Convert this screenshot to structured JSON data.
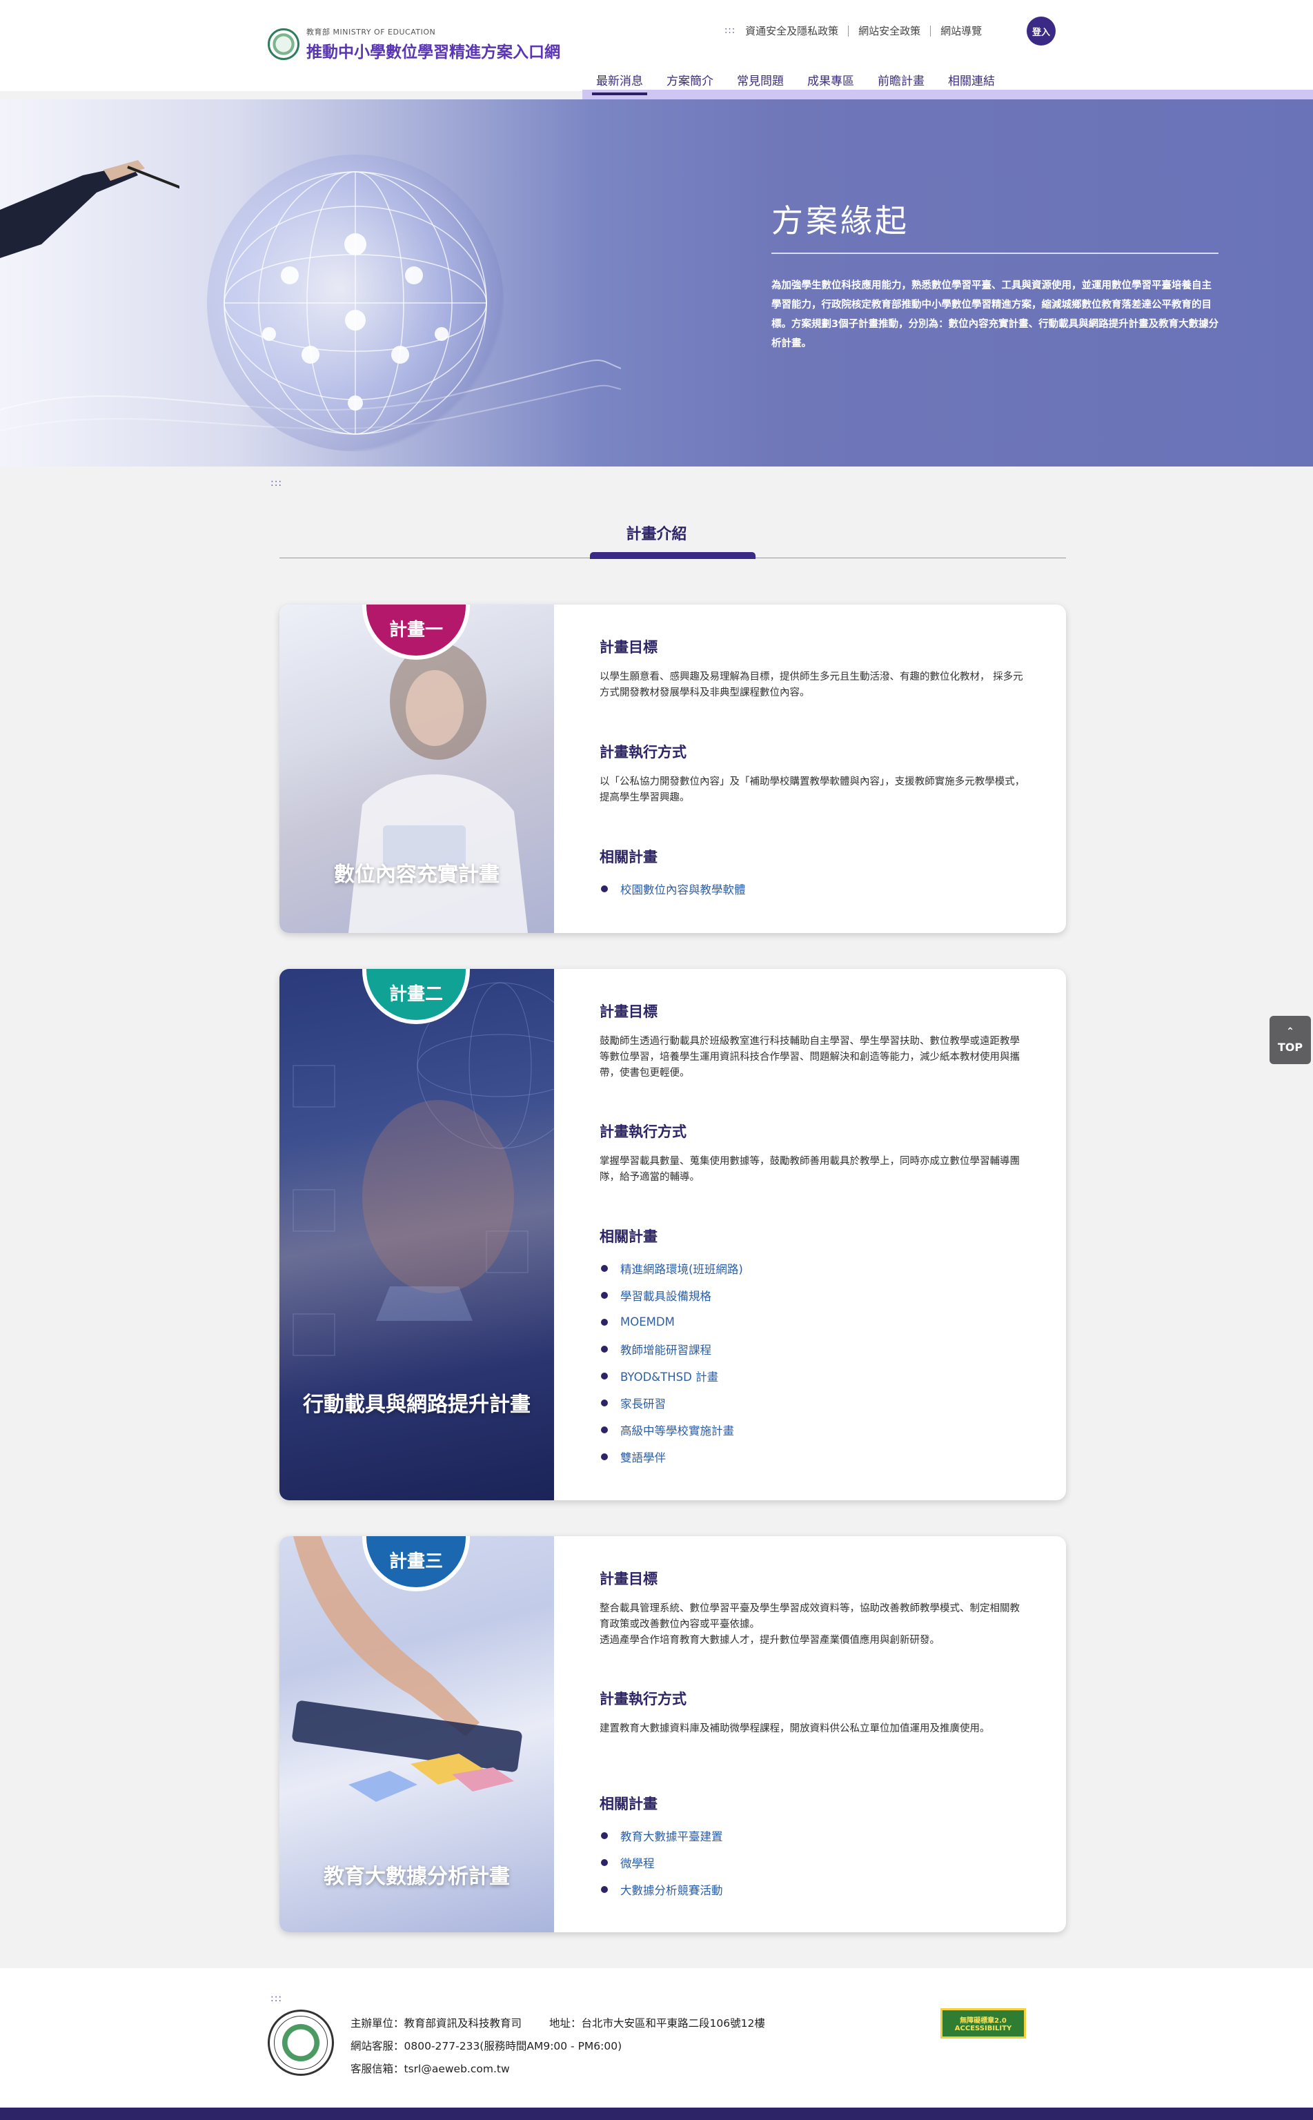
{
  "header": {
    "ministry": "教育部 MINISTRY OF EDUCATION",
    "site_title": "推動中小學數位學習精進方案入口網",
    "util_dots": ":::",
    "util_links": [
      "資通安全及隱私政策",
      "網站安全政策",
      "網站導覽"
    ],
    "login": "登入",
    "nav": [
      "最新消息",
      "方案簡介",
      "常見問題",
      "成果專區",
      "前瞻計畫",
      "相關連結"
    ],
    "active_nav": "最新消息"
  },
  "hero": {
    "title": "方案緣起",
    "description": "為加強學生數位科技應用能力，熟悉數位學習平臺、工具與資源使用，並運用數位學習平臺培養自主學習能力，行政院核定教育部推動中小學數位學習精進方案，縮減城鄉數位教育落差達公平教育的目標。方案規劃3個子計畫推動，分別為：數位內容充實計畫、行動載具與網路提升計畫及教育大數據分析計畫。"
  },
  "section": {
    "dots": ":::",
    "title": "計畫介紹"
  },
  "labels": {
    "goal": "計畫目標",
    "method": "計畫執行方式",
    "related": "相關計畫"
  },
  "plans": [
    {
      "badge": "計畫一",
      "badge_color": "#b3186b",
      "name": "數位內容充實計畫",
      "goal": "以學生願意看、感興趣及易理解為目標，提供師生多元且生動活潑、有趣的數位化教材， 採多元方式開發教材發展學科及非典型課程數位內容。",
      "method": "以「公私協力開發數位內容」及「補助學校購置教學軟體與內容」，支援教師實施多元教學模式，提高學生學習興趣。",
      "related": [
        "校園數位內容與教學軟體"
      ]
    },
    {
      "badge": "計畫二",
      "badge_color": "#0fa295",
      "name": "行動載具與網路提升計畫",
      "goal": "鼓勵師生透過行動載具於班級教室進行科技輔助自主學習、學生學習扶助、數位教學或遠距教學等數位學習，培養學生運用資訊科技合作學習、問題解決和創造等能力，減少紙本教材使用與攜帶，使書包更輕便。",
      "method": "掌握學習載具數量、蒐集使用數據等，鼓勵教師善用載具於教學上，同時亦成立數位學習輔導團隊，給予適當的輔導。",
      "related": [
        "精進網路環境(班班網路)",
        "學習載具設備規格",
        "MOEMDM",
        "教師增能研習課程",
        "BYOD&THSD 計畫",
        "家長研習",
        "高級中等學校實施計畫",
        "雙語學伴"
      ]
    },
    {
      "badge": "計畫三",
      "badge_color": "#1b68b0",
      "name": "教育大數據分析計畫",
      "goal": "整合載具管理系統、數位學習平臺及學生學習成效資料等，協助改善教師教學模式、制定相關教育政策或改善數位內容或平臺依據。\n透過產學合作培育教育大數據人才，提升數位學習產業價值應用與創新研發。",
      "method": "建置教育大數據資料庫及補助微學程課程，開放資料供公私立單位加值運用及推廣使用。",
      "related": [
        "教育大數據平臺建置",
        "微學程",
        "大數據分析競賽活動"
      ]
    }
  ],
  "top_button": "TOP",
  "footer": {
    "dots": ":::",
    "organizer": "主辦單位：教育部資訊及科技教育司",
    "address": "地址：台北市大安區和平東路二段106號12樓",
    "service": "網站客服：0800-277-233(服務時間AM9:00 - PM6:00)",
    "email": "客服信箱：tsrl@aeweb.com.tw",
    "a11y_line1": "無障礙標章2.0",
    "a11y_line2": "ACCESSIBILITY"
  }
}
